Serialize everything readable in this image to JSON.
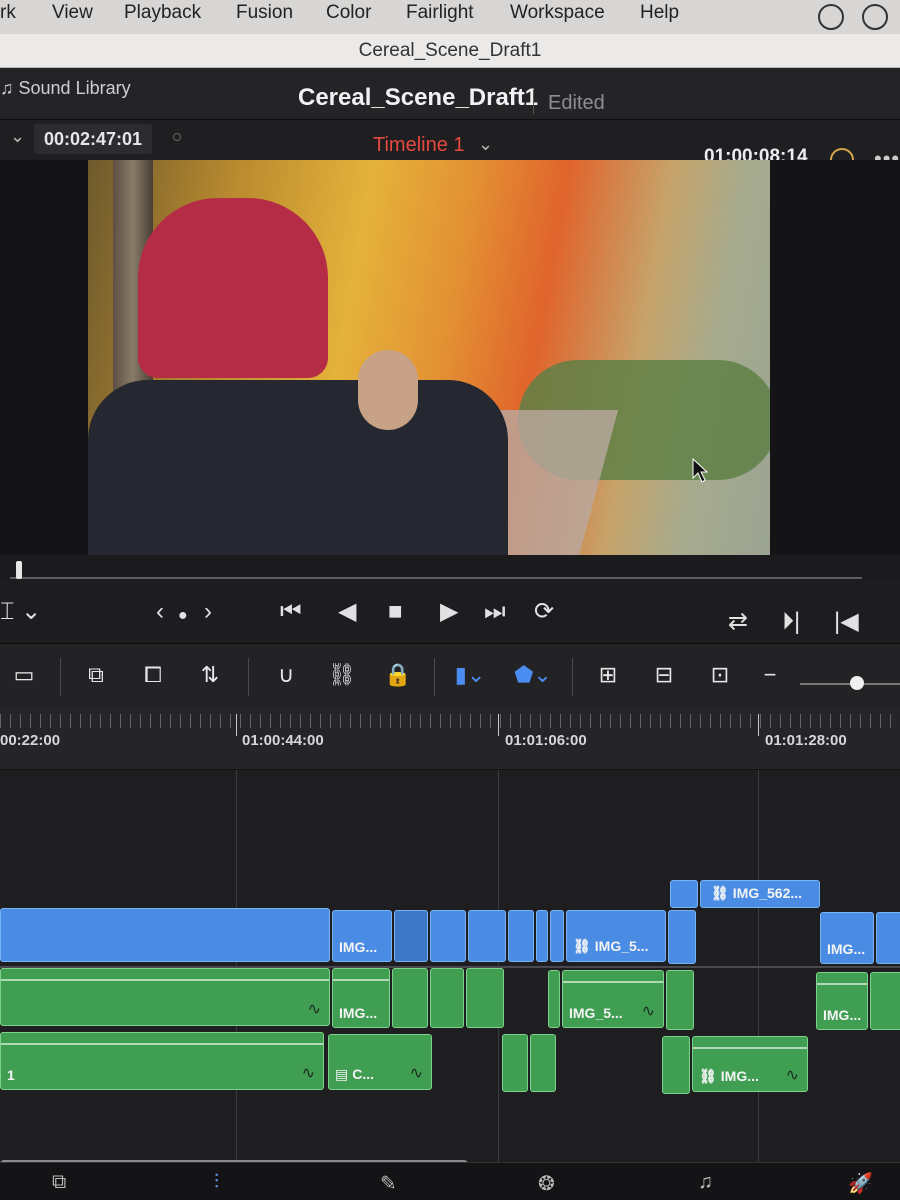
{
  "menu": [
    "rk",
    "View",
    "Playback",
    "Fusion",
    "Color",
    "Fairlight",
    "Workspace",
    "Help"
  ],
  "window_title": "Cereal_Scene_Draft1",
  "header": {
    "sound_library": "Sound Library",
    "project_name": "Cereal_Scene_Draft1",
    "status": "Edited"
  },
  "viewer": {
    "source_timecode": "00:02:47:01",
    "timeline_name": "Timeline 1",
    "record_timecode": "01:00:08:14"
  },
  "ruler": {
    "labels": [
      "00:22:00",
      "01:00:44:00",
      "01:01:06:00",
      "01:01:28:00"
    ]
  },
  "clips": {
    "v2_top": "IMG_562...",
    "v1_a": "IMG...",
    "v1_b": "IMG_5...",
    "v1_c": "IMG...",
    "a1_a": "IMG...",
    "a1_b": "IMG_5...",
    "a1_c": "IMG...",
    "a2_track": "1",
    "a2_a": "C...",
    "a2_b": "IMG..."
  },
  "icons": {
    "link": "link-icon",
    "fx": "effects-icon",
    "more": "more-icon"
  },
  "colors": {
    "video_clip": "#4a8ce3",
    "audio_clip": "#3f9e52",
    "timeline_name": "#e5483e"
  }
}
